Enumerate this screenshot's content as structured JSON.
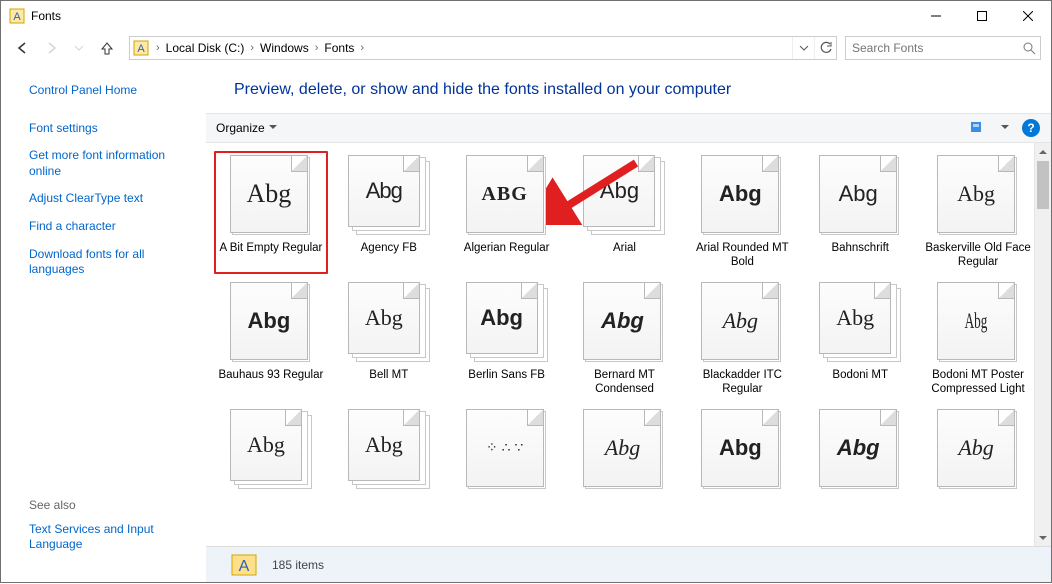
{
  "window": {
    "title": "Fonts"
  },
  "breadcrumb": {
    "items": [
      "Local Disk (C:)",
      "Windows",
      "Fonts"
    ]
  },
  "search": {
    "placeholder": "Search Fonts"
  },
  "sidebar": {
    "home": "Control Panel Home",
    "links": [
      "Font settings",
      "Get more font information online",
      "Adjust ClearType text",
      "Find a character",
      "Download fonts for all languages"
    ],
    "see_also_label": "See also",
    "see_also_links": [
      "Text Services and Input Language"
    ]
  },
  "main": {
    "heading": "Preview, delete, or show and hide the fonts installed on your computer",
    "organize_label": "Organize"
  },
  "fonts": [
    {
      "name": "A Bit Empty Regular",
      "sample": "Abg",
      "multi": false,
      "selected": true,
      "style": "font-family:Georgia,serif;font-size:26px;"
    },
    {
      "name": "Agency FB",
      "sample": "Abg",
      "multi": true,
      "style": "font-family:'Arial Narrow',sans-serif;font-size:22px;letter-spacing:-1px;"
    },
    {
      "name": "Algerian Regular",
      "sample": "ABG",
      "multi": false,
      "style": "font-family:serif;font-size:20px;font-weight:bold;letter-spacing:1px;"
    },
    {
      "name": "Arial",
      "sample": "Abg",
      "multi": true,
      "style": "font-family:Arial,sans-serif;"
    },
    {
      "name": "Arial Rounded MT Bold",
      "sample": "Abg",
      "multi": false,
      "style": "font-family:Arial,sans-serif;font-weight:bold;"
    },
    {
      "name": "Bahnschrift",
      "sample": "Abg",
      "multi": false,
      "style": "font-family:Bahnschrift,Arial,sans-serif;"
    },
    {
      "name": "Baskerville Old Face Regular",
      "sample": "Abg",
      "multi": false,
      "style": "font-family:Baskerville,Georgia,serif;"
    },
    {
      "name": "Bauhaus 93 Regular",
      "sample": "Abg",
      "multi": false,
      "style": "font-family:Impact,sans-serif;font-weight:900;"
    },
    {
      "name": "Bell MT",
      "sample": "Abg",
      "multi": true,
      "style": "font-family:Georgia,serif;"
    },
    {
      "name": "Berlin Sans FB",
      "sample": "Abg",
      "multi": true,
      "style": "font-family:Arial,sans-serif;font-weight:bold;"
    },
    {
      "name": "Bernard MT Condensed",
      "sample": "Abg",
      "multi": false,
      "style": "font-family:Impact,sans-serif;font-weight:900;font-style:italic;"
    },
    {
      "name": "Blackadder ITC Regular",
      "sample": "Abg",
      "multi": false,
      "style": "font-family:'Brush Script MT',cursive;font-style:italic;"
    },
    {
      "name": "Bodoni MT",
      "sample": "Abg",
      "multi": true,
      "style": "font-family:'Bodoni MT',Didot,serif;"
    },
    {
      "name": "Bodoni MT Poster Compressed Light",
      "sample": "Abg",
      "multi": false,
      "style": "font-family:Didot,serif;transform:scaleX(0.6);"
    },
    {
      "name": "",
      "sample": "Abg",
      "multi": true,
      "style": "font-family:Georgia,serif;"
    },
    {
      "name": "",
      "sample": "Abg",
      "multi": true,
      "style": "font-family:Georgia,serif;"
    },
    {
      "name": "",
      "sample": "⁘ ∴ ∵",
      "multi": false,
      "style": "font-size:14px;"
    },
    {
      "name": "",
      "sample": "Abg",
      "multi": false,
      "style": "font-family:'Comic Sans MS',cursive;font-style:italic;"
    },
    {
      "name": "",
      "sample": "Abg",
      "multi": false,
      "style": "font-family:Arial Black,sans-serif;font-weight:900;"
    },
    {
      "name": "",
      "sample": "Abg",
      "multi": false,
      "style": "font-family:Arial Black,sans-serif;font-weight:900;font-style:italic;"
    },
    {
      "name": "",
      "sample": "Abg",
      "multi": false,
      "style": "font-family:'Brush Script MT',cursive;font-style:italic;"
    }
  ],
  "status": {
    "text": "185 items"
  }
}
